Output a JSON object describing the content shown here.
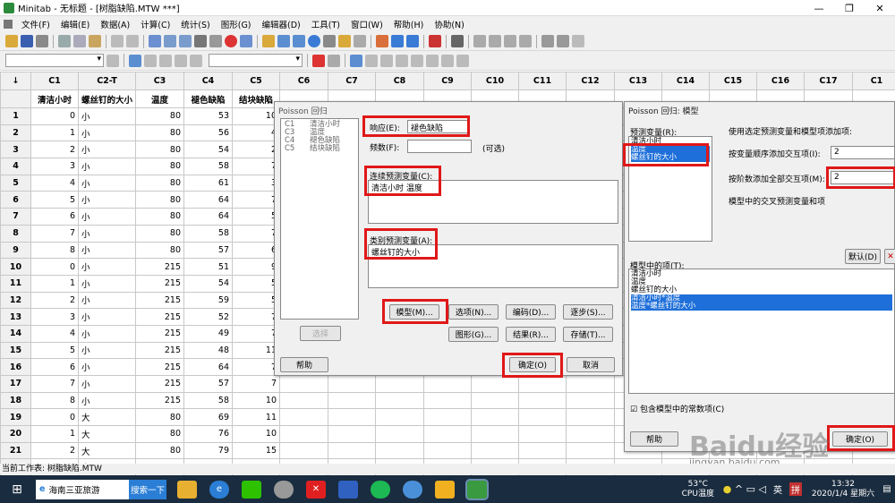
{
  "window": {
    "title": "Minitab - 无标题 - [树脂缺陷.MTW ***]"
  },
  "menu": [
    "文件(F)",
    "编辑(E)",
    "数据(A)",
    "计算(C)",
    "统计(S)",
    "图形(G)",
    "编辑器(D)",
    "工具(T)",
    "窗口(W)",
    "帮助(H)",
    "协助(N)"
  ],
  "grid": {
    "corner": "↓",
    "columns": [
      "C1",
      "C2-T",
      "C3",
      "C4",
      "C5",
      "C6",
      "C7",
      "C8",
      "C9",
      "C10",
      "C11",
      "C12",
      "C13",
      "C14",
      "C15",
      "C16",
      "C17",
      "C1"
    ],
    "names": [
      "清洁小时",
      "螺丝钉的大小",
      "温度",
      "褪色缺陷",
      "结块缺陷"
    ],
    "rows": [
      [
        "1",
        "0",
        "小",
        "80",
        "53",
        "10"
      ],
      [
        "2",
        "1",
        "小",
        "80",
        "56",
        "4"
      ],
      [
        "3",
        "2",
        "小",
        "80",
        "54",
        "2"
      ],
      [
        "4",
        "3",
        "小",
        "80",
        "58",
        "7"
      ],
      [
        "5",
        "4",
        "小",
        "80",
        "61",
        "3"
      ],
      [
        "6",
        "5",
        "小",
        "80",
        "64",
        "7"
      ],
      [
        "7",
        "6",
        "小",
        "80",
        "64",
        "5"
      ],
      [
        "8",
        "7",
        "小",
        "80",
        "58",
        "7"
      ],
      [
        "9",
        "8",
        "小",
        "80",
        "57",
        "6"
      ],
      [
        "10",
        "0",
        "小",
        "215",
        "51",
        "9"
      ],
      [
        "11",
        "1",
        "小",
        "215",
        "54",
        "5"
      ],
      [
        "12",
        "2",
        "小",
        "215",
        "59",
        "5"
      ],
      [
        "13",
        "3",
        "小",
        "215",
        "52",
        "7"
      ],
      [
        "14",
        "4",
        "小",
        "215",
        "49",
        "7"
      ],
      [
        "15",
        "5",
        "小",
        "215",
        "48",
        "11"
      ],
      [
        "16",
        "6",
        "小",
        "215",
        "64",
        "7"
      ],
      [
        "17",
        "7",
        "小",
        "215",
        "57",
        "7"
      ],
      [
        "18",
        "8",
        "小",
        "215",
        "58",
        "10"
      ],
      [
        "19",
        "0",
        "大",
        "80",
        "69",
        "11"
      ],
      [
        "20",
        "1",
        "大",
        "80",
        "76",
        "10"
      ],
      [
        "21",
        "2",
        "大",
        "80",
        "79",
        "15"
      ],
      [
        "22",
        "3",
        "大",
        "80",
        "82",
        "15"
      ]
    ]
  },
  "poisson": {
    "title": "Poisson 回归",
    "varlist": [
      [
        "C1",
        "清洁小时"
      ],
      [
        "C3",
        "温度"
      ],
      [
        "C4",
        "褪色缺陷"
      ],
      [
        "C5",
        "结块缺陷"
      ]
    ],
    "response_label": "响应(E):",
    "response_value": "褪色缺陷",
    "freq_label": "频数(F):",
    "optional": "(可选)",
    "continuous_label": "连续预测变量(C):",
    "continuous_value": "清洁小时 温度",
    "categorical_label": "类别预测变量(A):",
    "categorical_value": "螺丝钉的大小",
    "select_btn": "选择",
    "buttons": [
      "模型(M)...",
      "选项(N)...",
      "编码(D)...",
      "逐步(S)...",
      "图形(G)...",
      "结果(R)...",
      "存储(T)..."
    ],
    "help": "帮助",
    "ok": "确定(O)",
    "cancel": "取消"
  },
  "model": {
    "title": "Poisson 回归: 模型",
    "predictors_label": "预测变量(R):",
    "predictors": [
      "清洁小时",
      "温度",
      "螺丝钉的大小"
    ],
    "instruction": "使用选定预测变量和模型项添加项:",
    "order_label": "按变量顺序添加交互项(I):",
    "order_value": "2",
    "degree_label": "按阶数添加全部交互项(M):",
    "degree_value": "2",
    "cross_label": "模型中的交叉预测变量和项",
    "default_btn": "默认(D)",
    "terms_label": "模型中的项(T):",
    "terms": [
      "清洁小时",
      "温度",
      "螺丝钉的大小",
      "清洁小时*温度",
      "温度*螺丝钉的大小"
    ],
    "constant_label": "包含模型中的常数项(C)",
    "help": "帮助",
    "ok": "确定(O)"
  },
  "status": {
    "text": "当前工作表: 树脂缺陷.MTW"
  },
  "watermark": {
    "brand": "Baidu经验",
    "url": "jingyan.baidu.com"
  },
  "taskbar": {
    "search_text": "海南三亚旅游",
    "search_btn": "搜索一下",
    "temp": "53°C",
    "cpu": "CPU温度",
    "ime": "英",
    "ime2": "拼",
    "time": "13:32",
    "date": "2020/1/4 星期六"
  }
}
